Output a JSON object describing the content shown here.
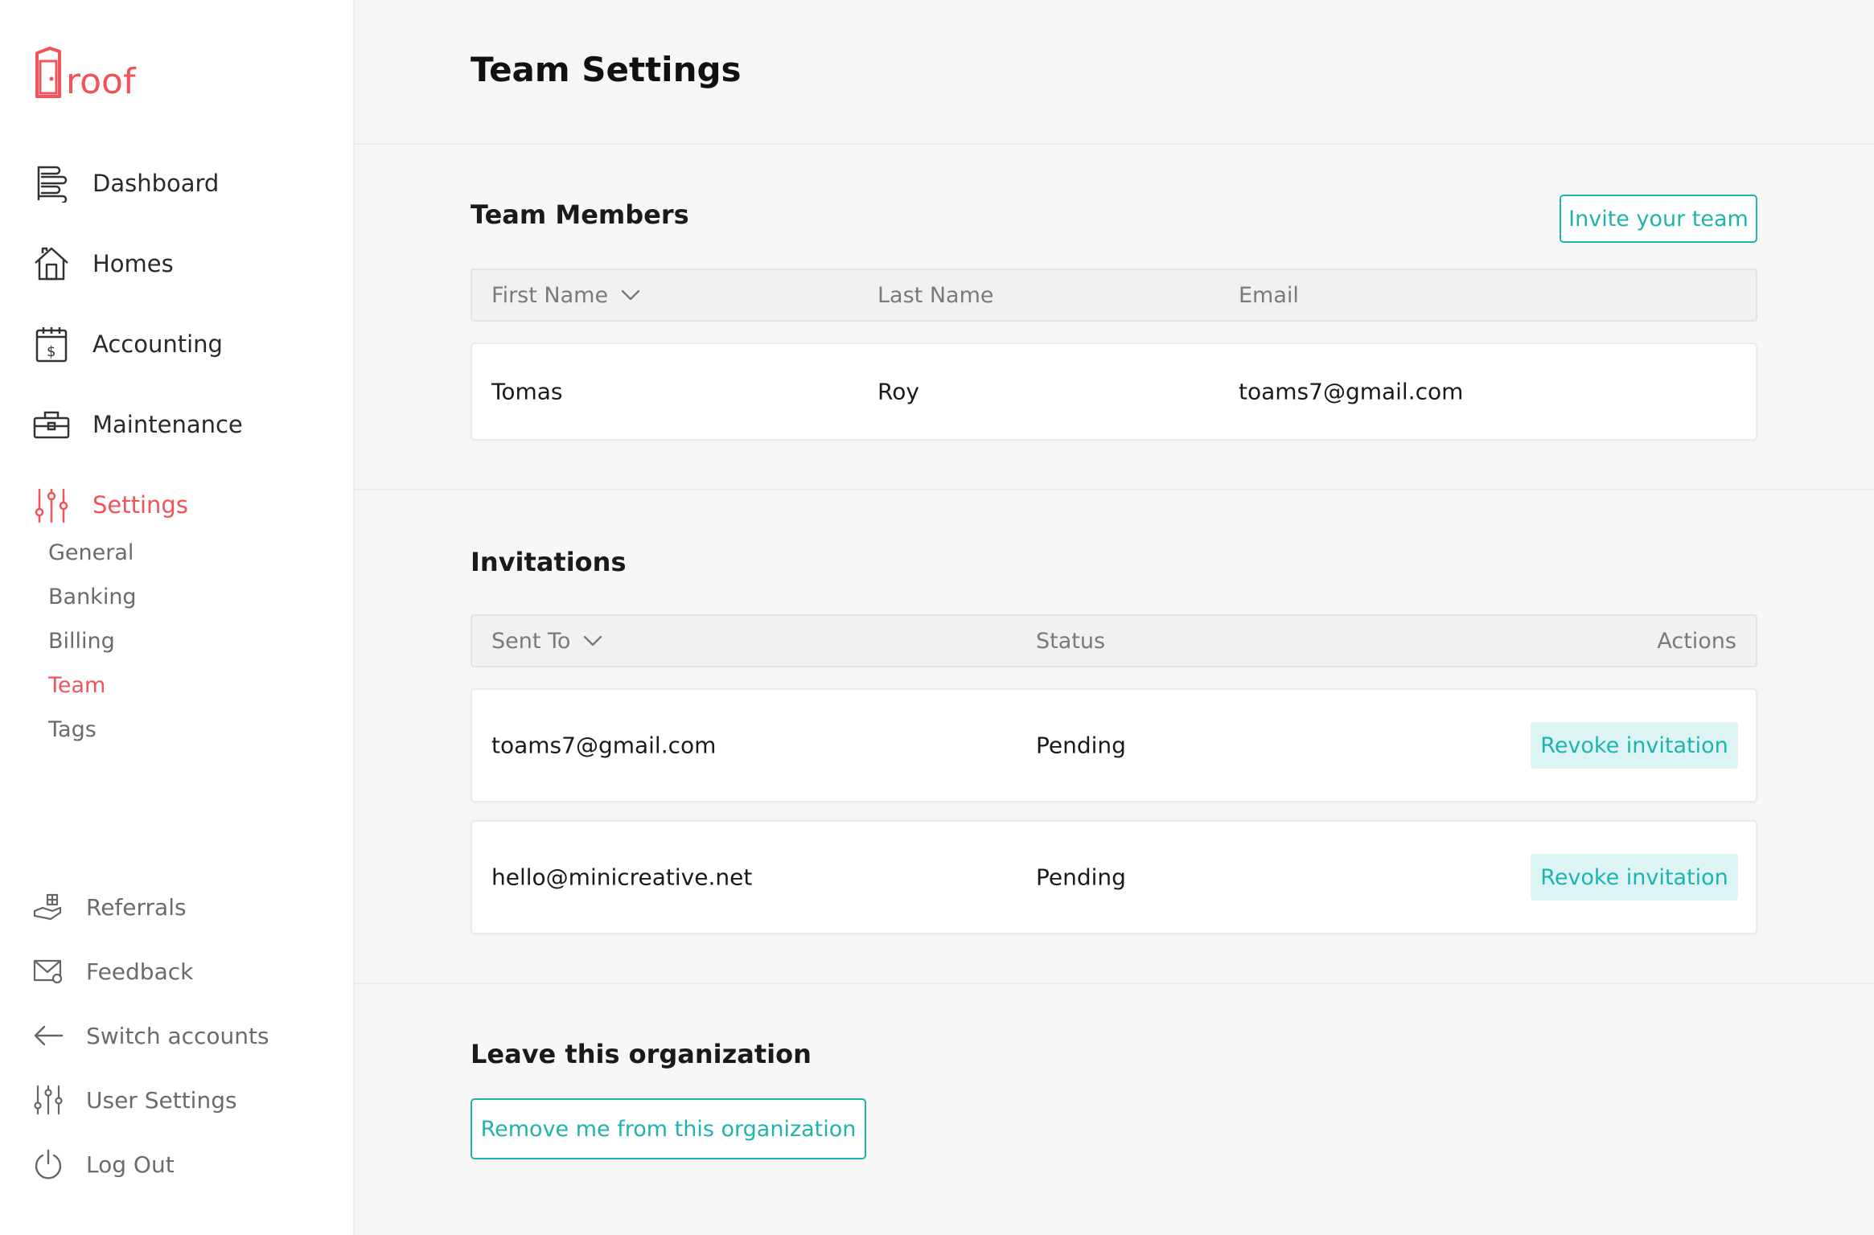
{
  "brand": {
    "logo_text": "roof",
    "accent": "#f0535a",
    "teal": "#1fb3ad"
  },
  "sidebar": {
    "nav": [
      {
        "label": "Dashboard",
        "icon": "dashboard-icon"
      },
      {
        "label": "Homes",
        "icon": "home-icon"
      },
      {
        "label": "Accounting",
        "icon": "accounting-icon"
      },
      {
        "label": "Maintenance",
        "icon": "toolbox-icon"
      },
      {
        "label": "Settings",
        "icon": "sliders-icon",
        "active": true
      }
    ],
    "settings_sub": [
      {
        "label": "General"
      },
      {
        "label": "Banking"
      },
      {
        "label": "Billing"
      },
      {
        "label": "Team",
        "active": true
      },
      {
        "label": "Tags"
      }
    ],
    "bottom": [
      {
        "label": "Referrals",
        "icon": "referral-gift-icon"
      },
      {
        "label": "Feedback",
        "icon": "feedback-mail-icon"
      },
      {
        "label": "Switch accounts",
        "icon": "arrow-left-icon"
      },
      {
        "label": "User Settings",
        "icon": "sliders-icon"
      },
      {
        "label": "Log Out",
        "icon": "power-icon"
      }
    ]
  },
  "page": {
    "title": "Team Settings"
  },
  "members": {
    "title": "Team Members",
    "invite_button": "Invite your team",
    "columns": {
      "first": "First Name",
      "last": "Last Name",
      "email": "Email"
    },
    "rows": [
      {
        "first": "Tomas",
        "last": "Roy",
        "email": "toams7@gmail.com"
      }
    ]
  },
  "invitations": {
    "title": "Invitations",
    "columns": {
      "sent_to": "Sent To",
      "status": "Status",
      "actions": "Actions"
    },
    "rows": [
      {
        "sent_to": "toams7@gmail.com",
        "status": "Pending",
        "action": "Revoke invitation"
      },
      {
        "sent_to": "hello@minicreative.net",
        "status": "Pending",
        "action": "Revoke invitation"
      }
    ]
  },
  "leave": {
    "title": "Leave this organization",
    "button": "Remove me from this organization"
  }
}
